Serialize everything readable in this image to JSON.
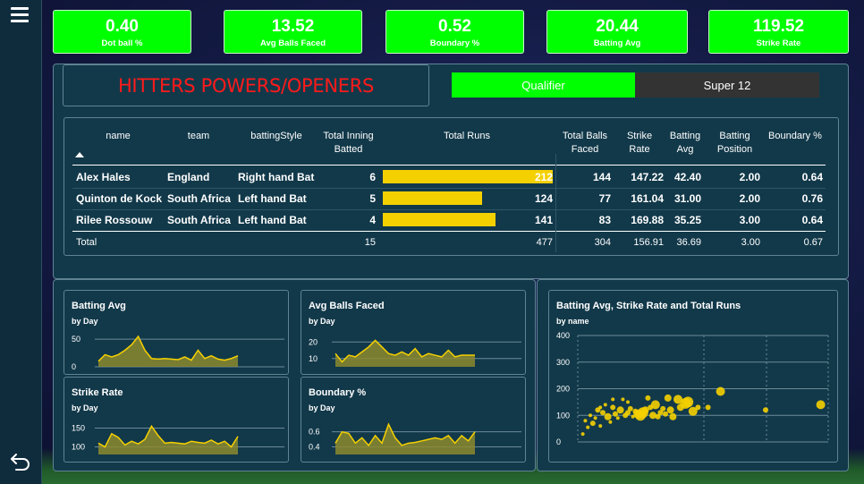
{
  "kpis": [
    {
      "value": "0.40",
      "label": "Dot ball %"
    },
    {
      "value": "13.52",
      "label": "Avg Balls Faced"
    },
    {
      "value": "0.52",
      "label": "Boundary %"
    },
    {
      "value": "20.44",
      "label": "Batting Avg"
    },
    {
      "value": "119.52",
      "label": "Strike Rate"
    }
  ],
  "page_title": "HITTERS POWERS/OPENERS",
  "toggle": {
    "left": "Qualifier",
    "right": "Super 12",
    "active": "Qualifier"
  },
  "table": {
    "headers": {
      "name": "name",
      "team": "team",
      "style": "battingStyle",
      "innings": "Total Inning Batted",
      "runs": "Total Runs",
      "balls": "Total Balls Faced",
      "sr": "Strike Rate",
      "avg": "Batting Avg",
      "pos": "Batting Position",
      "bnd": "Boundary %"
    },
    "rows": [
      {
        "name": "Alex Hales",
        "team": "England",
        "style": "Right hand Bat",
        "innings": "6",
        "runs": 212,
        "runs_label": "212",
        "balls": "144",
        "sr": "147.22",
        "avg": "42.40",
        "pos": "2.00",
        "bnd": "0.64"
      },
      {
        "name": "Quinton de Kock",
        "team": "South Africa",
        "style": "Left hand Bat",
        "innings": "5",
        "runs": 124,
        "runs_label": "124",
        "balls": "77",
        "sr": "161.04",
        "avg": "31.00",
        "pos": "2.00",
        "bnd": "0.76"
      },
      {
        "name": "Rilee Rossouw",
        "team": "South Africa",
        "style": "Left hand Bat",
        "innings": "4",
        "runs": 141,
        "runs_label": "141",
        "balls": "83",
        "sr": "169.88",
        "avg": "35.25",
        "pos": "3.00",
        "bnd": "0.64"
      }
    ],
    "total": {
      "label": "Total",
      "innings": "15",
      "runs": "477",
      "balls": "304",
      "sr": "156.91",
      "avg": "36.69",
      "pos": "3.00",
      "bnd": "0.67"
    }
  },
  "colors": {
    "kpi": "#00ff00",
    "bar": "#f5d000",
    "title": "#ff1a1a",
    "panel": "#12394a",
    "toggle_active": "#00ff00",
    "toggle_inactive": "#333333"
  },
  "icons": {
    "menu": "hamburger-menu-icon",
    "back": "back-arrow-icon"
  },
  "chart_data": [
    {
      "type": "area",
      "title": "Batting Avg",
      "subtitle": "by Day",
      "yticks": [
        "50",
        "0"
      ],
      "ylim": [
        0,
        60
      ],
      "values": [
        10,
        22,
        18,
        22,
        30,
        40,
        55,
        30,
        15,
        14,
        15,
        14,
        13,
        18,
        12,
        30,
        15,
        20,
        14,
        12,
        15,
        20
      ]
    },
    {
      "type": "area",
      "title": "Avg Balls Faced",
      "subtitle": "by Day",
      "yticks": [
        "20",
        "10"
      ],
      "ylim": [
        5,
        25
      ],
      "values": [
        13,
        8,
        12,
        11,
        14,
        17,
        21,
        17,
        13,
        12,
        14,
        12,
        16,
        11,
        13,
        12,
        11,
        15,
        11,
        12,
        12,
        12
      ]
    },
    {
      "type": "area",
      "title": "Strike Rate",
      "subtitle": "by Day",
      "yticks": [
        "150",
        "100"
      ],
      "ylim": [
        80,
        170
      ],
      "values": [
        110,
        100,
        135,
        125,
        105,
        115,
        108,
        120,
        155,
        130,
        110,
        112,
        110,
        108,
        115,
        112,
        110,
        118,
        108,
        115,
        100,
        128
      ]
    },
    {
      "type": "area",
      "title": "Boundary %",
      "subtitle": "by Day",
      "yticks": [
        "0.6",
        "0.4"
      ],
      "ylim": [
        0.3,
        0.75
      ],
      "values": [
        0.45,
        0.6,
        0.58,
        0.45,
        0.52,
        0.42,
        0.55,
        0.45,
        0.7,
        0.52,
        0.42,
        0.45,
        0.46,
        0.48,
        0.5,
        0.52,
        0.5,
        0.55,
        0.45,
        0.55,
        0.48,
        0.6
      ]
    },
    {
      "type": "scatter",
      "title": "Batting Avg, Strike Rate and Total Runs",
      "subtitle": "by name",
      "yticks": [
        "400",
        "300",
        "200",
        "100",
        "0"
      ],
      "ylim": [
        0,
        400
      ],
      "xlim": [
        0,
        100
      ],
      "points": [
        {
          "x": 2,
          "y": 30,
          "r": 2
        },
        {
          "x": 3,
          "y": 80,
          "r": 2
        },
        {
          "x": 4,
          "y": 55,
          "r": 2
        },
        {
          "x": 5,
          "y": 100,
          "r": 2
        },
        {
          "x": 6,
          "y": 70,
          "r": 3
        },
        {
          "x": 7,
          "y": 90,
          "r": 2
        },
        {
          "x": 8,
          "y": 120,
          "r": 3
        },
        {
          "x": 9,
          "y": 60,
          "r": 2
        },
        {
          "x": 10,
          "y": 110,
          "r": 3
        },
        {
          "x": 11,
          "y": 140,
          "r": 2
        },
        {
          "x": 12,
          "y": 95,
          "r": 4
        },
        {
          "x": 13,
          "y": 75,
          "r": 2
        },
        {
          "x": 14,
          "y": 130,
          "r": 3
        },
        {
          "x": 15,
          "y": 105,
          "r": 3
        },
        {
          "x": 16,
          "y": 90,
          "r": 2
        },
        {
          "x": 17,
          "y": 120,
          "r": 4
        },
        {
          "x": 18,
          "y": 160,
          "r": 2
        },
        {
          "x": 19,
          "y": 100,
          "r": 3
        },
        {
          "x": 20,
          "y": 110,
          "r": 3
        },
        {
          "x": 21,
          "y": 125,
          "r": 3
        },
        {
          "x": 22,
          "y": 95,
          "r": 2
        },
        {
          "x": 23,
          "y": 115,
          "r": 3
        },
        {
          "x": 24,
          "y": 105,
          "r": 5
        },
        {
          "x": 25,
          "y": 100,
          "r": 6
        },
        {
          "x": 26,
          "y": 110,
          "r": 6
        },
        {
          "x": 27,
          "y": 120,
          "r": 4
        },
        {
          "x": 28,
          "y": 165,
          "r": 3
        },
        {
          "x": 29,
          "y": 130,
          "r": 3
        },
        {
          "x": 30,
          "y": 100,
          "r": 4
        },
        {
          "x": 31,
          "y": 140,
          "r": 5
        },
        {
          "x": 32,
          "y": 95,
          "r": 3
        },
        {
          "x": 33,
          "y": 110,
          "r": 3
        },
        {
          "x": 34,
          "y": 125,
          "r": 3
        },
        {
          "x": 35,
          "y": 105,
          "r": 3
        },
        {
          "x": 36,
          "y": 165,
          "r": 4
        },
        {
          "x": 37,
          "y": 120,
          "r": 4
        },
        {
          "x": 38,
          "y": 95,
          "r": 4
        },
        {
          "x": 40,
          "y": 160,
          "r": 5
        },
        {
          "x": 41,
          "y": 130,
          "r": 4
        },
        {
          "x": 43,
          "y": 145,
          "r": 6
        },
        {
          "x": 44,
          "y": 150,
          "r": 6
        },
        {
          "x": 46,
          "y": 115,
          "r": 5
        },
        {
          "x": 48,
          "y": 130,
          "r": 3
        },
        {
          "x": 52,
          "y": 130,
          "r": 3
        },
        {
          "x": 57,
          "y": 190,
          "r": 5
        },
        {
          "x": 75,
          "y": 120,
          "r": 3
        },
        {
          "x": 97,
          "y": 140,
          "r": 5
        },
        {
          "x": 20,
          "y": 150,
          "r": 2
        },
        {
          "x": 14,
          "y": 160,
          "r": 2
        },
        {
          "x": 9,
          "y": 130,
          "r": 2
        }
      ]
    }
  ]
}
